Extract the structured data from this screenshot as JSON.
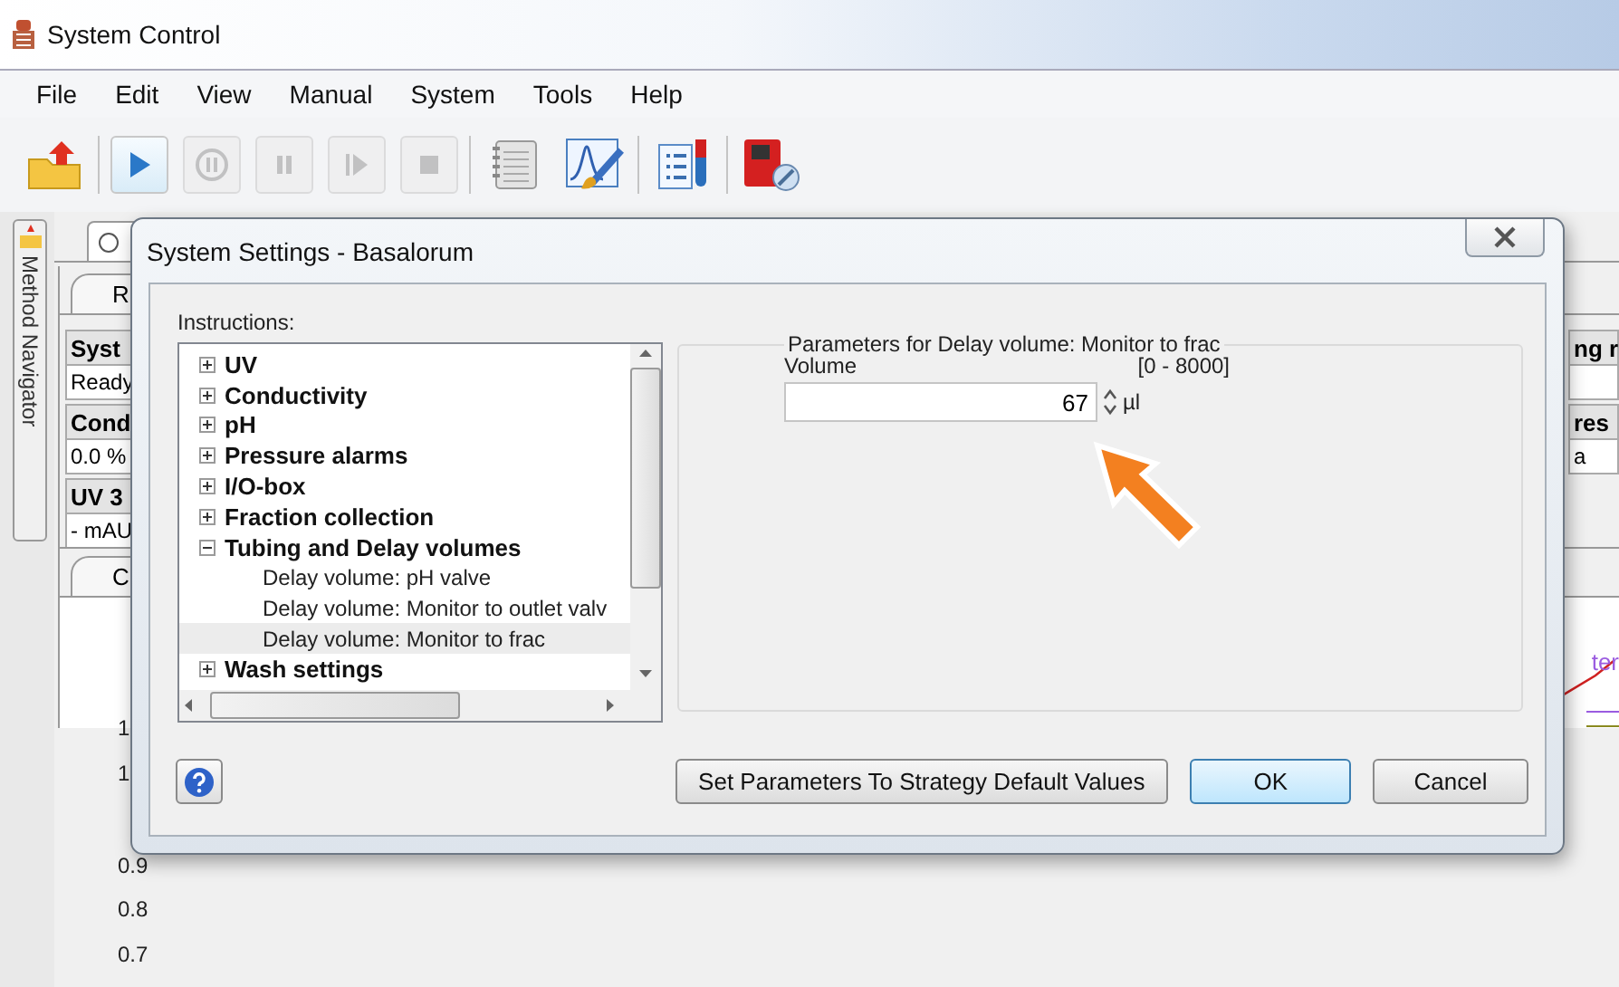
{
  "app_window": {
    "title": "System Control"
  },
  "menu": [
    "File",
    "Edit",
    "View",
    "Manual",
    "System",
    "Tools",
    "Help"
  ],
  "toolbar": [
    [
      {
        "kind": "open",
        "disabled": false
      }
    ],
    [
      {
        "kind": "run",
        "disabled": false
      },
      {
        "kind": "hold",
        "disabled": true
      },
      {
        "kind": "pause",
        "disabled": true
      },
      {
        "kind": "continue",
        "disabled": true
      },
      {
        "kind": "end",
        "disabled": true
      }
    ],
    [
      {
        "kind": "log",
        "disabled": false
      },
      {
        "kind": "evaluate",
        "disabled": false
      }
    ],
    [
      {
        "kind": "method",
        "disabled": false
      }
    ],
    [
      {
        "kind": "system",
        "disabled": false
      }
    ]
  ],
  "side_tab": "Method Navigator",
  "run_data": {
    "tab": "R",
    "left_cells": [
      {
        "heading": "Syst",
        "value": "Ready"
      },
      {
        "heading": "Cond",
        "value": "0.0 %"
      },
      {
        "heading": "UV 3",
        "value": "- mAU"
      }
    ],
    "right_cells": [
      {
        "heading": "ng r"
      },
      {
        "heading": "res",
        "value": "a"
      }
    ]
  },
  "chart": {
    "tab": "C",
    "legend_text": "ter",
    "y_ticks": [
      "1",
      "1",
      "0.9",
      "0.8",
      "0.7"
    ]
  },
  "dialog": {
    "title": "System Settings - Basalorum",
    "instructions_label": "Instructions:",
    "tree": [
      {
        "label": "UV",
        "expanded": false,
        "selected": false
      },
      {
        "label": "Conductivity",
        "expanded": false,
        "selected": false
      },
      {
        "label": "pH",
        "expanded": false,
        "selected": false
      },
      {
        "label": "Pressure alarms",
        "expanded": false,
        "selected": false
      },
      {
        "label": "I/O-box",
        "expanded": false,
        "selected": false
      },
      {
        "label": "Fraction collection",
        "expanded": false,
        "selected": false
      },
      {
        "label": "Tubing and Delay volumes",
        "expanded": true,
        "selected": false,
        "children": [
          {
            "label": "Delay volume: pH valve",
            "selected": false
          },
          {
            "label": "Delay volume: Monitor to outlet valv",
            "selected": false
          },
          {
            "label": "Delay volume: Monitor to frac",
            "selected": true
          }
        ]
      },
      {
        "label": "Wash settings",
        "expanded": false,
        "selected": false
      }
    ],
    "parameters": {
      "legend": "Parameters for Delay volume: Monitor to frac",
      "fields": [
        {
          "label": "Volume",
          "range": "[0 - 8000]",
          "value": "67",
          "unit": "µl"
        }
      ]
    },
    "buttons": [
      {
        "label": "Set Parameters To Strategy Default Values",
        "default": false
      },
      {
        "label": "OK",
        "default": true
      },
      {
        "label": "Cancel",
        "default": false
      }
    ]
  }
}
